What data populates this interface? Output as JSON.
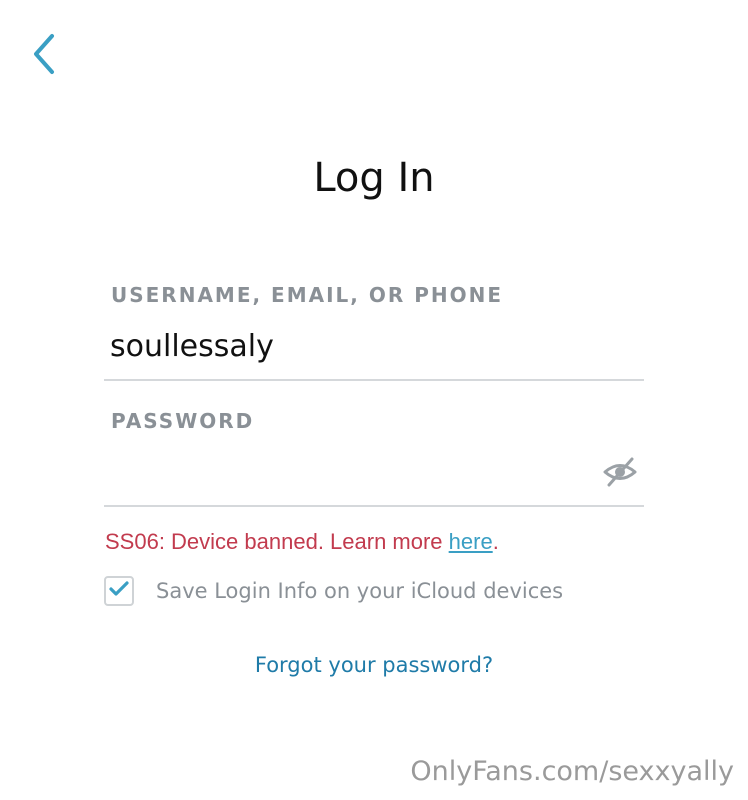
{
  "header": {
    "back_icon": "chevron-left-icon",
    "title": "Log In"
  },
  "form": {
    "username": {
      "label": "USERNAME, EMAIL, OR PHONE",
      "value": "soullessaly"
    },
    "password": {
      "label": "PASSWORD",
      "value": "",
      "toggle_icon": "eye-slash-icon"
    },
    "error": {
      "prefix": "SS06: Device banned. Learn more ",
      "link_text": "here",
      "suffix": "."
    },
    "save_login": {
      "checked": true,
      "label": "Save Login Info on your iCloud devices"
    },
    "forgot_password": "Forgot your password?"
  },
  "watermark": "OnlyFans.com/sexxyally",
  "colors": {
    "accent": "#3a9fc4",
    "link": "#1f7ba8",
    "error": "#c23b4e",
    "label": "#8a9096",
    "divider": "#d5d8db"
  }
}
